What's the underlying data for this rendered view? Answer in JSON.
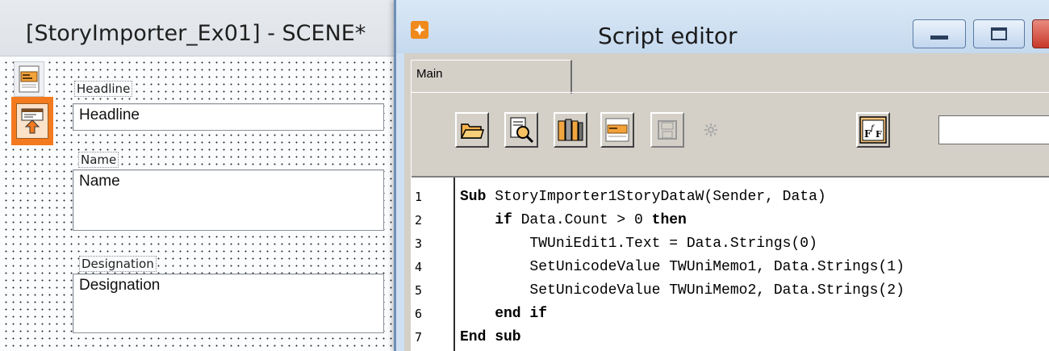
{
  "designer": {
    "title": "[StoryImporter_Ex01] - SCENE*",
    "fields": {
      "headline_label": "Headline",
      "headline_value": "Headline",
      "name_label": "Name",
      "name_value": "Name",
      "designation_label": "Designation",
      "designation_value": "Designation"
    }
  },
  "editor": {
    "title": "Script editor",
    "tabs": [
      {
        "label": "Main",
        "active": true
      }
    ],
    "toolbar": {
      "buttons": [
        "open-folder-icon",
        "find-icon",
        "library-icon",
        "form-list-icon",
        "save-icon",
        "compile-icon",
        "function-icon"
      ],
      "search_value": ""
    },
    "code": {
      "line_numbers": [
        "1",
        "2",
        "3",
        "4",
        "5",
        "6",
        "7"
      ],
      "lines": [
        [
          {
            "t": "Sub",
            "kw": true
          },
          {
            "t": " StoryImporter1StoryDataW(Sender, Data)"
          }
        ],
        [
          {
            "t": "    if",
            "kw": true
          },
          {
            "t": " Data.Count > 0 "
          },
          {
            "t": "then",
            "kw": true
          }
        ],
        [
          {
            "t": "        TWUniEdit1.Text = Data.Strings(0)"
          }
        ],
        [
          {
            "t": "        SetUnicodeValue TWUniMemo1, Data.Strings(1)"
          }
        ],
        [
          {
            "t": "        SetUnicodeValue TWUniMemo2, Data.Strings(2)"
          }
        ],
        [
          {
            "t": "    end if",
            "kw": true
          }
        ],
        [
          {
            "t": "End sub",
            "kw": true
          }
        ]
      ]
    }
  },
  "colors": {
    "accent_orange": "#f37a1f",
    "editor_frame": "#cfe0f2",
    "panel_gray": "#d4d0c8"
  }
}
